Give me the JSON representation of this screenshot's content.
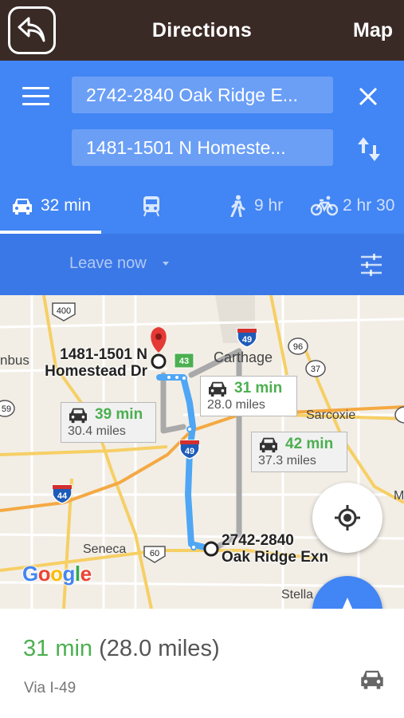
{
  "appbar": {
    "title": "Directions",
    "map_label": "Map",
    "back_icon": "back-arrow-icon"
  },
  "directions": {
    "origin": "2742-2840 Oak Ridge E...",
    "destination": "1481-1501 N Homeste...",
    "modes": [
      {
        "icon": "car-icon",
        "label": "32 min",
        "active": true
      },
      {
        "icon": "train-icon",
        "label": ""
      },
      {
        "icon": "walk-icon",
        "label": "9 hr"
      },
      {
        "icon": "bike-icon",
        "label": "2 hr 30"
      }
    ],
    "leave_now": "Leave now"
  },
  "map": {
    "labels": [
      "Carthage",
      "Sarcoxie",
      "Seneca",
      "Stella",
      "nbus"
    ],
    "highway_shields": [
      "400",
      "49",
      "96",
      "37",
      "43",
      "49",
      "44",
      "60",
      "59",
      "M"
    ],
    "destination_label_line1": "1481-1501 N",
    "destination_label_line2": "Homestead Dr",
    "origin_label_line1": "2742-2840",
    "origin_label_line2": "Oak Ridge Exn",
    "routes": [
      {
        "time": "31 min",
        "distance": "28.0 miles",
        "selected": true
      },
      {
        "time": "39 min",
        "distance": "30.4 miles",
        "selected": false
      },
      {
        "time": "42 min",
        "distance": "37.3 miles",
        "selected": false
      }
    ],
    "logo": "Google"
  },
  "summary": {
    "time": "31 min",
    "distance": "(28.0 miles)",
    "via": "Via I-49"
  },
  "colors": {
    "appbar": "#3a2a26",
    "header": "#4285f4",
    "options_bar": "#3b78e7",
    "route_selected": "#4fa6f5",
    "route_alt": "#a9a9a9",
    "time_green": "#4caf50"
  }
}
